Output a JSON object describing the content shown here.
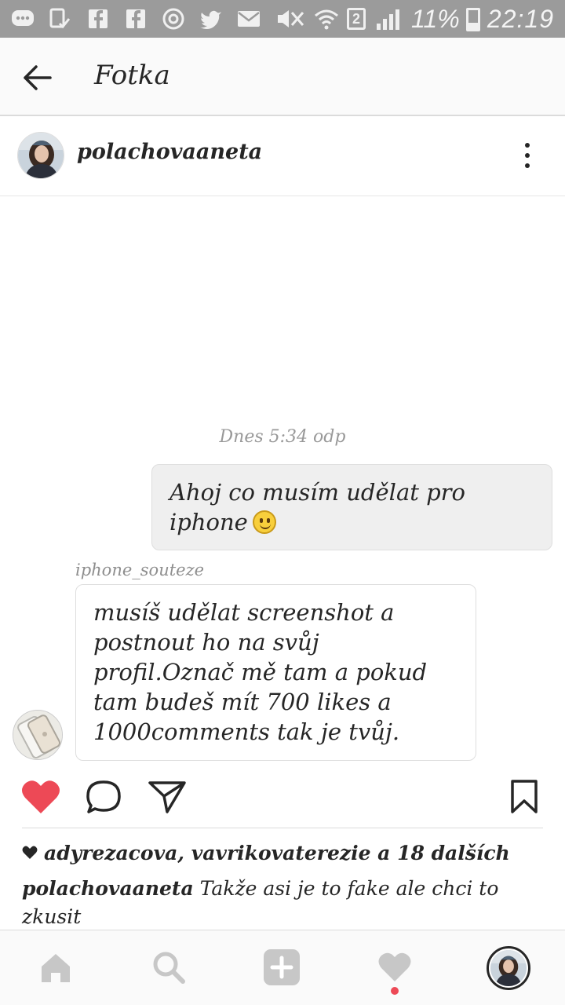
{
  "status_bar": {
    "battery_percent": "11%",
    "time": "22:19",
    "sim_slot": "2",
    "icons": [
      "chat-bubble-icon",
      "check-screen-icon",
      "facebook-icon",
      "facebook-icon",
      "instagram-icon",
      "twitter-icon",
      "mail-icon",
      "mute-icon",
      "wifi-icon",
      "sim-icon",
      "signal-icon",
      "battery-icon"
    ]
  },
  "header": {
    "title": "Fotka"
  },
  "post": {
    "username": "polachovaaneta",
    "photo": {
      "dm_time": "Dnes 5:34 odp",
      "outgoing_message": "Ahoj co musím udělat pro iphone",
      "sender_name": "iphone_souteze",
      "incoming_message": "musíš udělat screenshot a postnout ho na svůj profil.Označ mě tam a pokud tam budeš mít 700 likes a 1000comments tak je tvůj."
    },
    "likes_text": "adyrezacova, vavrikovaterezie a 18 dalších",
    "caption_user": "polachovaaneta",
    "caption_text": "Takže asi je to fake ale chci to zkusit"
  },
  "colors": {
    "like_red": "#ed4956",
    "status_bar_bg": "#9b9b9b",
    "text": "#262626"
  }
}
